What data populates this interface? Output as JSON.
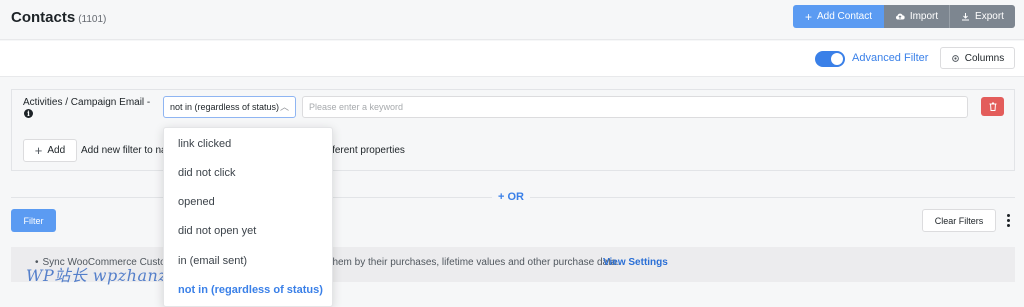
{
  "header": {
    "title": "Contacts",
    "count": "(1101)",
    "add_contact": "Add Contact",
    "import": "Import",
    "export": "Export"
  },
  "toolbar": {
    "advanced_filter": "Advanced Filter",
    "advanced_filter_enabled": true,
    "columns": "Columns"
  },
  "filter": {
    "property_label": "Activities / Campaign Email -",
    "operator_value": "not in (regardless of status)",
    "keyword_placeholder": "Please enter a keyword",
    "add_label": "Add",
    "add_hint": "Add new filter to narrow down your contacts based on different properties"
  },
  "dropdown": {
    "options": [
      "link clicked",
      "did not click",
      "opened",
      "did not open yet",
      "in (email sent)",
      "not in (regardless of status)"
    ],
    "selected_index": 5
  },
  "or_label": "OR",
  "actions": {
    "filter": "Filter",
    "clear_filters": "Clear Filters"
  },
  "notice": {
    "text": "Sync WooCommerce Customers data to FluentCRM to segment them by their purchases, lifetime values and other purchase data.",
    "link": "View Settings"
  },
  "watermark": "WP站长 wpzhanzhang.eastfu.com",
  "colors": {
    "primary": "#5b9bf2",
    "accent": "#3a80e8",
    "danger": "#e35d5b",
    "secondary_button": "#7d8690"
  }
}
